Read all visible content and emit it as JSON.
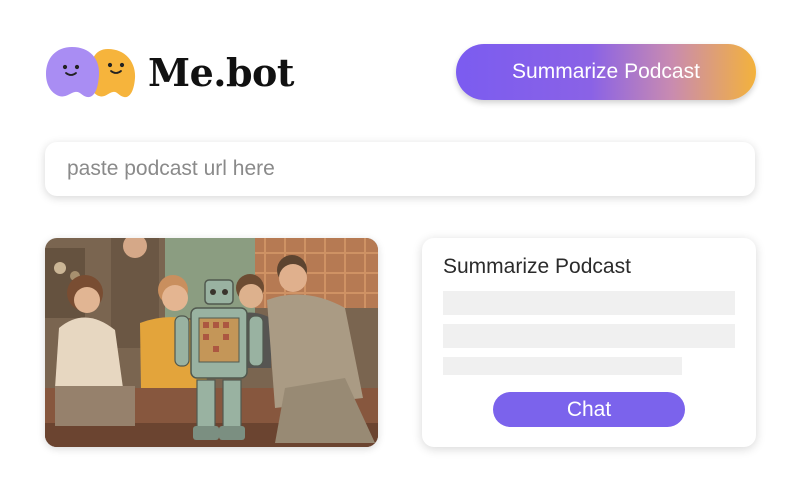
{
  "brand": {
    "name": "Me.bot",
    "logo_icon": "twin-blob-mascot-icon",
    "mascot_colors": [
      "#a98df3",
      "#f6b43c"
    ]
  },
  "header": {
    "summarize_button_label": "Summarize Podcast"
  },
  "search": {
    "value": "",
    "placeholder": "paste podcast url here"
  },
  "media": {
    "image_icon": "retro-family-robot-illustration"
  },
  "summary_card": {
    "title": "Summarize Podcast",
    "chat_button_label": "Chat"
  },
  "colors": {
    "accent_purple": "#7b63ec",
    "accent_orange": "#f3b23c",
    "skeleton_gray": "#f0f0f0",
    "text_dark": "#111111"
  }
}
